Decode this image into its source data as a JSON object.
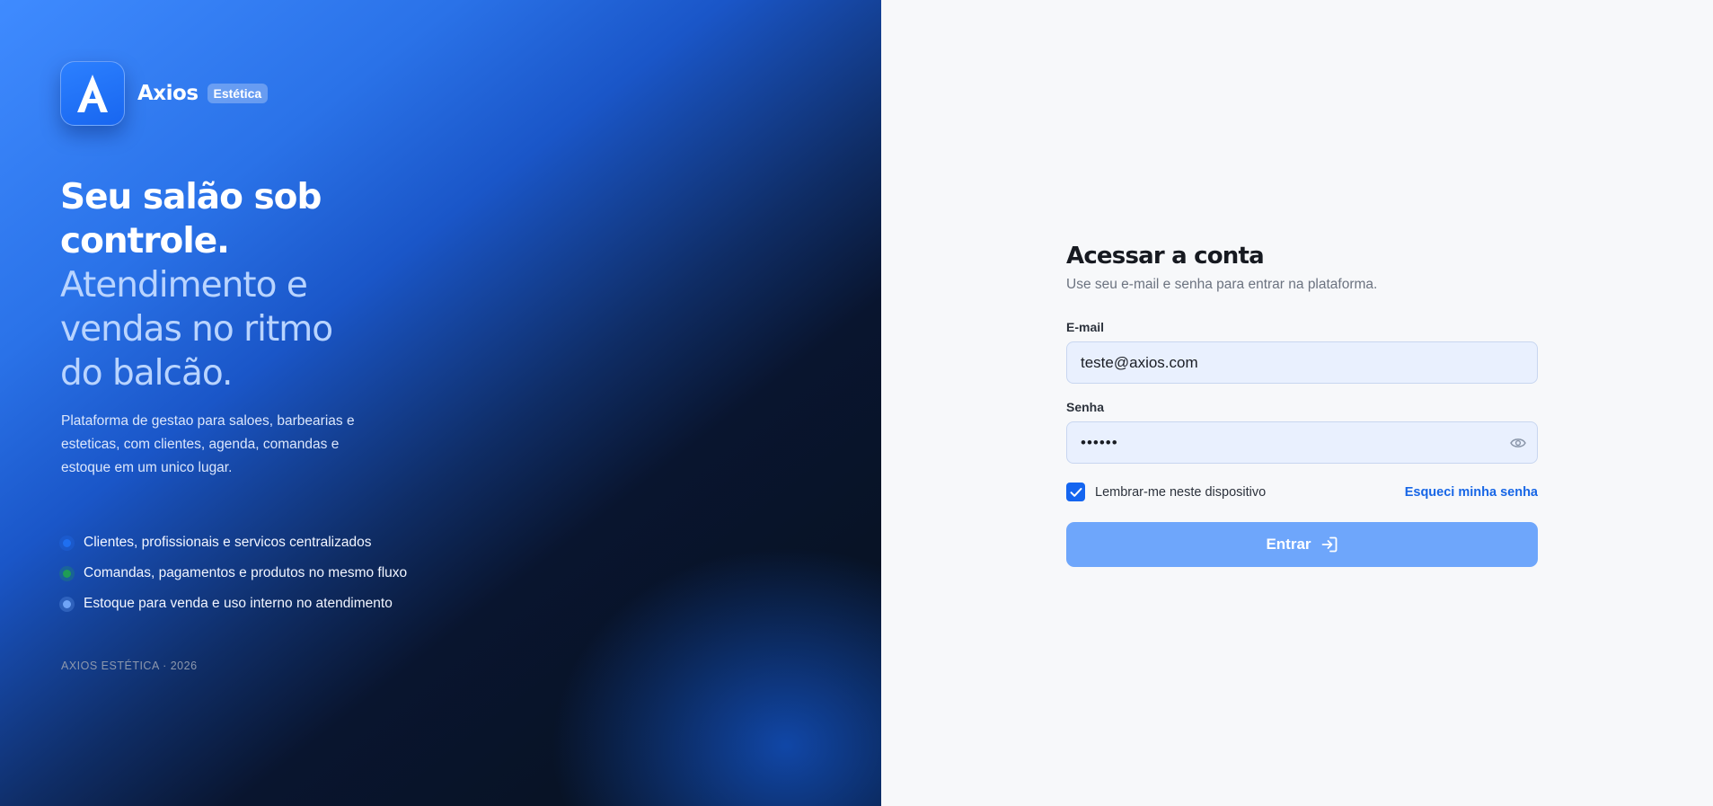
{
  "brand": {
    "logo_letter": "A",
    "name": "Axios",
    "badge": "Estética"
  },
  "hero": {
    "headline_strong": "Seu salão sob controle.",
    "headline_light": "Atendimento e vendas no ritmo do balcão.",
    "description": "Plataforma de gestao para saloes, barbearias e esteticas, com clientes, agenda, comandas e estoque em um unico lugar.",
    "features": [
      {
        "label": "Clientes, profissionais e servicos centralizados",
        "color": "#1f6ff0"
      },
      {
        "label": "Comandas, pagamentos e produtos no mesmo fluxo",
        "color": "#1f9d55"
      },
      {
        "label": "Estoque para venda e uso interno no atendimento",
        "color": "#6fa4f7"
      }
    ],
    "footer": "AXIOS ESTÉTICA · 2026"
  },
  "login": {
    "title": "Acessar a conta",
    "subtitle": "Use seu e-mail e senha para entrar na plataforma.",
    "email_label": "E-mail",
    "email_value": "teste@axios.com",
    "password_label": "Senha",
    "password_value": "••••••",
    "remember_label": "Lembrar-me neste dispositivo",
    "remember_checked": true,
    "forgot_label": "Esqueci minha senha",
    "submit_label": "Entrar"
  },
  "colors": {
    "accent": "#1465f0",
    "submit_button": "#6ea6fb"
  }
}
